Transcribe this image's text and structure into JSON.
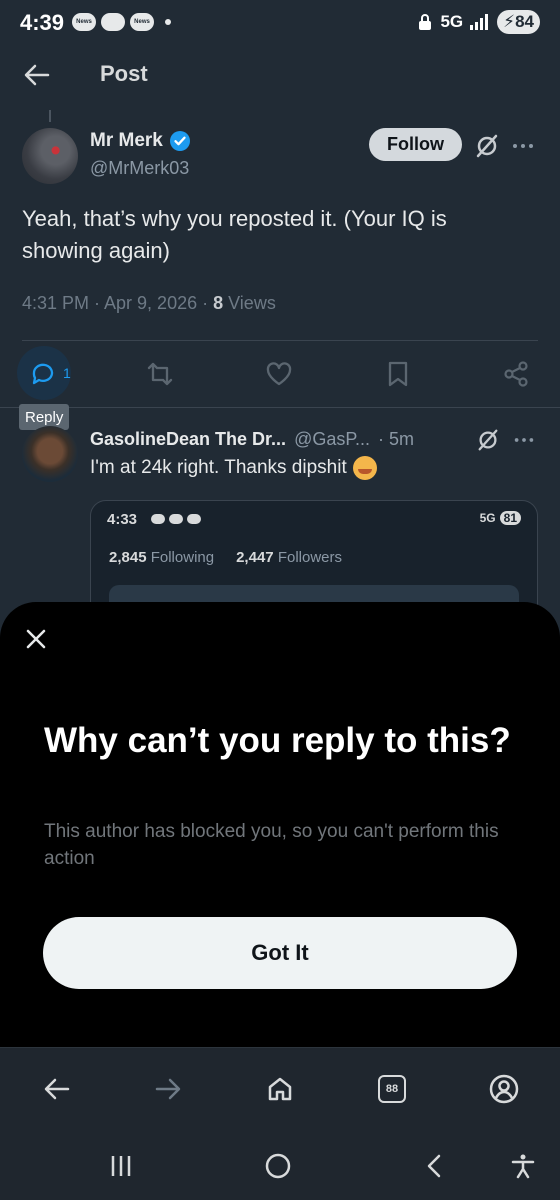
{
  "status_bar": {
    "time": "4:39",
    "notif_icons": [
      "News",
      "",
      "News"
    ],
    "network": "5G",
    "battery": "84"
  },
  "header": {
    "title": "Post"
  },
  "post": {
    "author_name": "Mr Merk",
    "author_handle": "@MrMerk03",
    "follow_label": "Follow",
    "text": "Yeah, that’s why you reposted it. (Your IQ is showing again)",
    "meta_time": "4:31 PM · Apr 9, 2026 · ",
    "views_count": "8",
    "views_label": " Views",
    "reply_count": "1",
    "tooltip": "Reply"
  },
  "reply": {
    "name": "GasolineDean The Dr...",
    "handle": "@GasP...",
    "time": "· 5m",
    "text": "I'm at 24k right. Thanks dipshit",
    "media": {
      "time": "4:33",
      "network": "5G",
      "battery": "81",
      "following_count": "2,845",
      "following_label": "Following",
      "followers_count": "2,447",
      "followers_label": "Followers"
    }
  },
  "sheet": {
    "title": "Why can’t you reply to this?",
    "description": "This author has blocked you, so you can't perform this action",
    "button_label": "Got It"
  },
  "browser_nav": {
    "tabs_count": "88"
  },
  "colors": {
    "accent": "#1d9bf0",
    "background": "#212b35",
    "sheet": "#000000"
  }
}
